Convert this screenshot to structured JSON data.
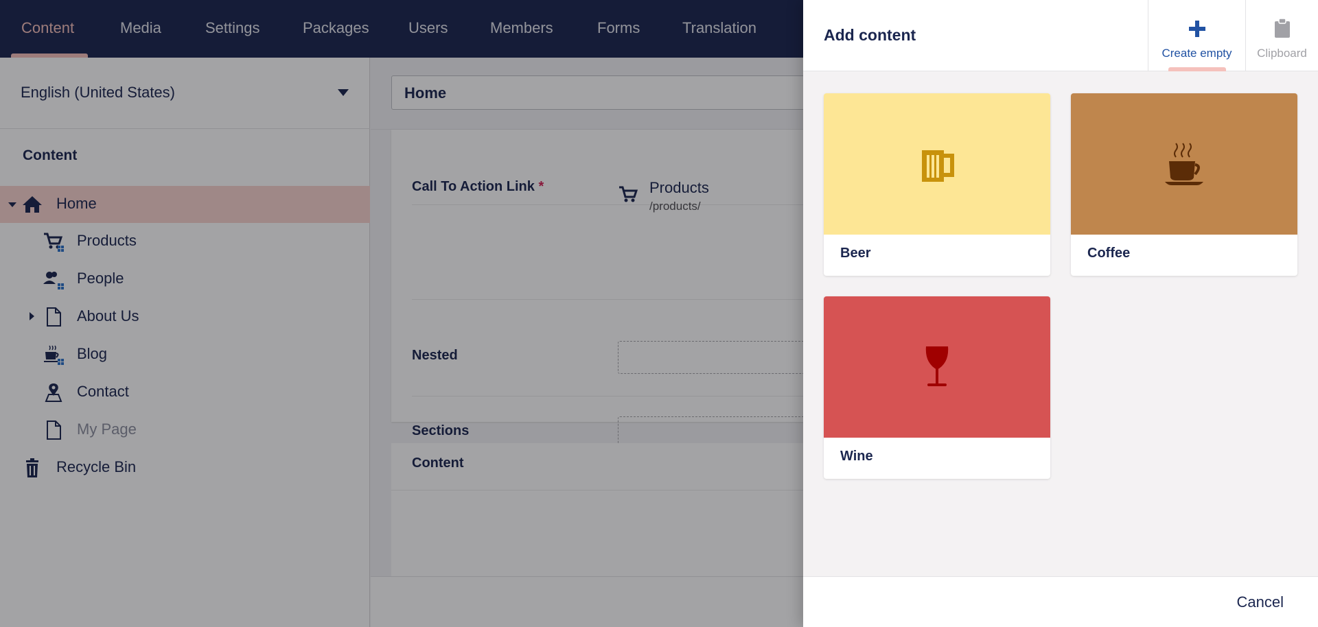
{
  "topnav": {
    "tabs": [
      {
        "label": "Content",
        "active": true
      },
      {
        "label": "Media"
      },
      {
        "label": "Settings"
      },
      {
        "label": "Packages"
      },
      {
        "label": "Users"
      },
      {
        "label": "Members"
      },
      {
        "label": "Forms"
      },
      {
        "label": "Translation"
      }
    ],
    "colors": {
      "background": "#1b264f",
      "active": "#f5c1bc"
    }
  },
  "tree": {
    "language": "English (United States)",
    "heading": "Content",
    "items": [
      {
        "label": "Home",
        "icon": "home-icon",
        "selected": true,
        "expanded": true
      },
      {
        "label": "Products",
        "icon": "cart-list-icon"
      },
      {
        "label": "People",
        "icon": "people-list-icon"
      },
      {
        "label": "About Us",
        "icon": "document-icon",
        "collapsed": true
      },
      {
        "label": "Blog",
        "icon": "coffee-list-icon"
      },
      {
        "label": "Contact",
        "icon": "map-pin-icon"
      },
      {
        "label": "My Page",
        "icon": "document-icon",
        "unpublished": true
      },
      {
        "label": "Recycle Bin",
        "icon": "trash-icon"
      }
    ]
  },
  "editor": {
    "name_value": "Home",
    "properties": {
      "cta_label": "Call To Action Link",
      "cta_required_mark": "*",
      "cta_link_name": "Products",
      "cta_link_url": "/products/",
      "nested_label": "Nested",
      "sections_label": "Sections"
    },
    "content_group_title": "Content"
  },
  "dialog": {
    "title": "Add content",
    "create_empty_label": "Create empty",
    "clipboard_label": "Clipboard",
    "cancel_label": "Cancel",
    "blocks": [
      {
        "name": "Beer",
        "icon": "beer-mug-icon",
        "bg": "#fde695",
        "icon_color": "#c8920c"
      },
      {
        "name": "Coffee",
        "icon": "coffee-cup-icon",
        "bg": "#bf864d",
        "icon_color": "#5b2c07"
      },
      {
        "name": "Wine",
        "icon": "wine-glass-icon",
        "bg": "#d65353",
        "icon_color": "#a00000"
      }
    ]
  }
}
